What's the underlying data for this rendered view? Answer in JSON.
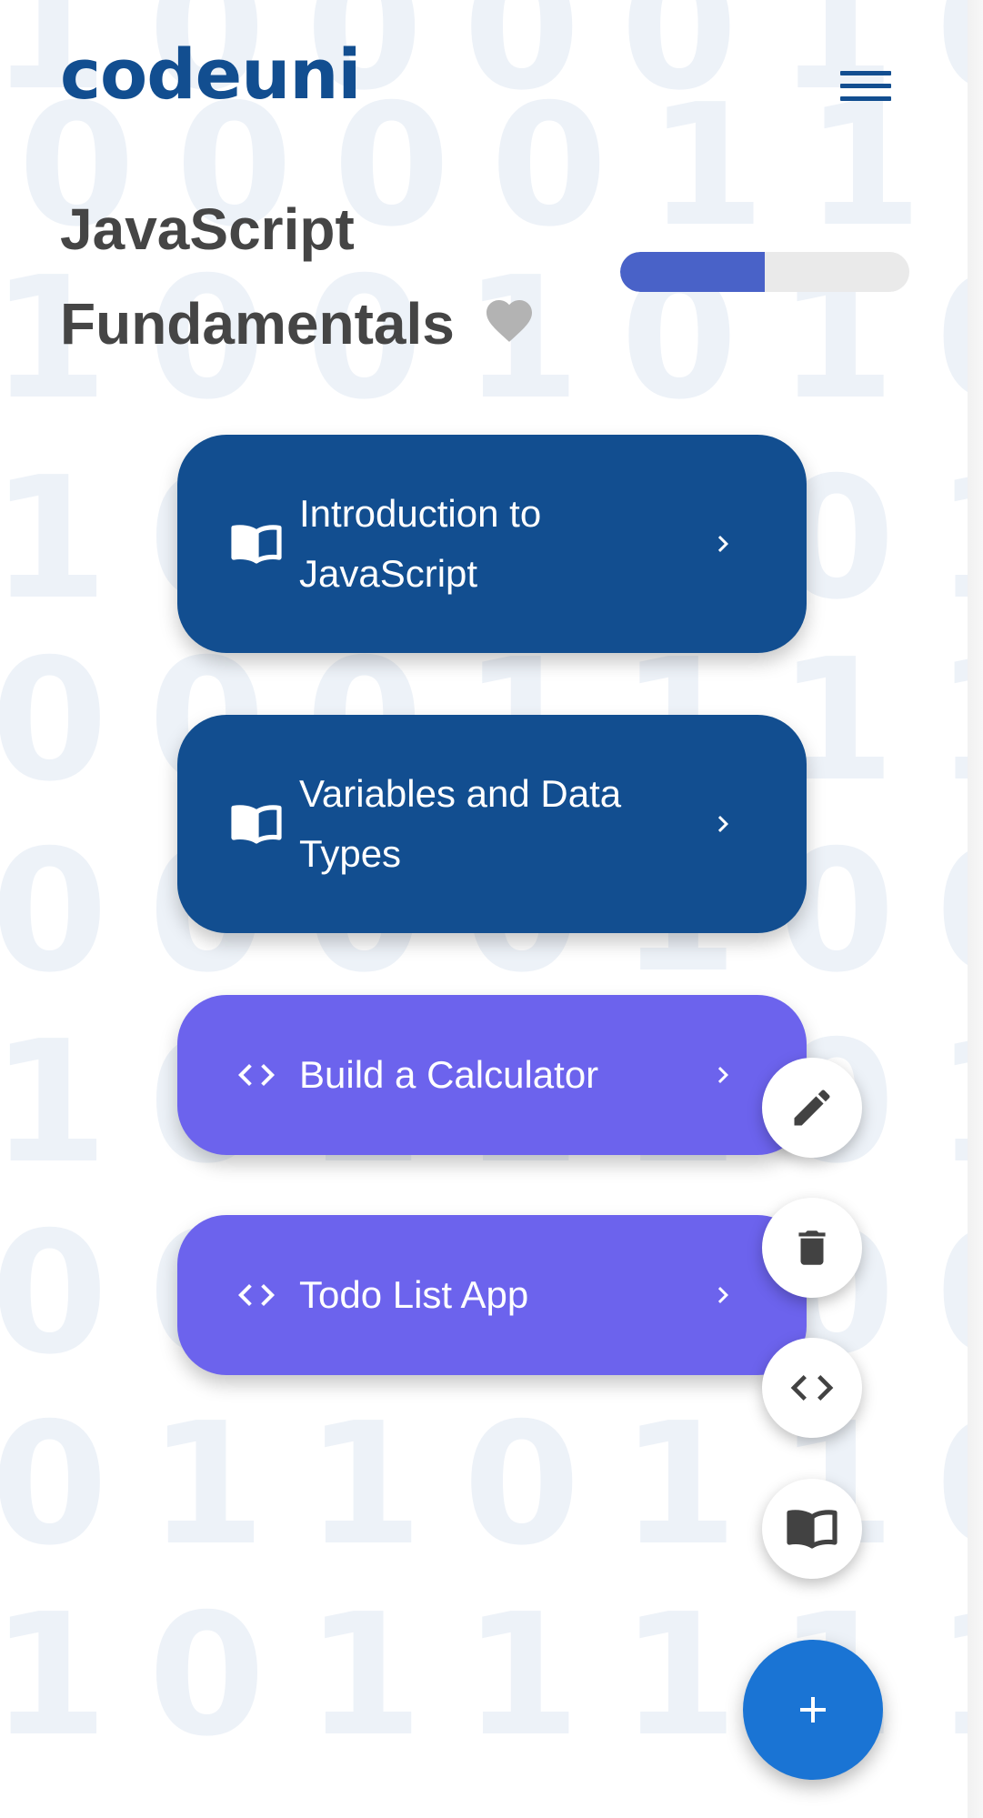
{
  "app": {
    "logo": "codeuni"
  },
  "header": {
    "menu_icon": "hamburger-menu-icon"
  },
  "course": {
    "title": "JavaScript Fundamentals",
    "favorite_icon": "heart-icon",
    "progress": 0.5,
    "colors": {
      "progress_fill": "#4962c8",
      "progress_track": "#eaeaea"
    }
  },
  "items": [
    {
      "label": "Introduction to JavaScript",
      "type": "lesson",
      "icon": "book-icon"
    },
    {
      "label": "Variables and Data Types",
      "type": "lesson",
      "icon": "book-icon"
    },
    {
      "label": "Build a Calculator",
      "type": "project",
      "icon": "code-icon"
    },
    {
      "label": "Todo List App",
      "type": "project",
      "icon": "code-icon"
    }
  ],
  "fab": {
    "main_icon": "plus-icon",
    "actions": [
      "edit-icon",
      "delete-icon",
      "code-icon",
      "book-icon"
    ]
  },
  "colors": {
    "brand": "#124e90",
    "lesson_card": "#124e90",
    "project_card": "#6c63ed",
    "fab": "#1a74d4",
    "title_text": "#454545"
  }
}
